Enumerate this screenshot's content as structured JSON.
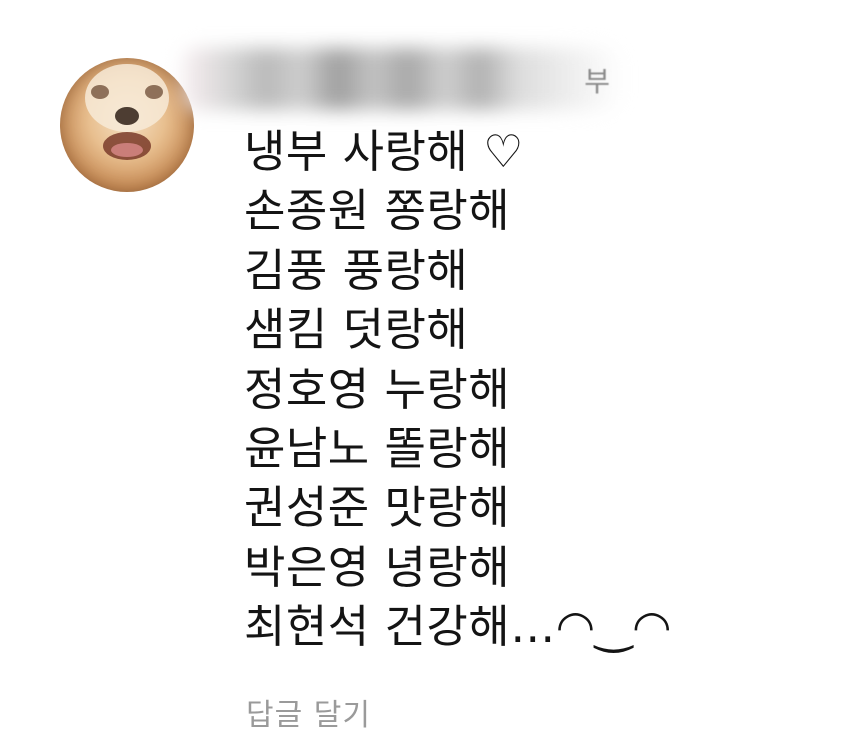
{
  "comment": {
    "avatar_icon": "puppy-avatar",
    "username_edge_glyph": "부",
    "lines": [
      "냉부 사랑해 ♡",
      "손종원 쫑랑해",
      "김풍 풍랑해",
      "샘킴 덧랑해",
      "정호영 누랑해",
      "윤남노 똘랑해",
      "권성준 맛랑해",
      "박은영 녕랑해",
      "최현석 건강해…◠‿◠"
    ],
    "reply_label": "답글 달기"
  }
}
